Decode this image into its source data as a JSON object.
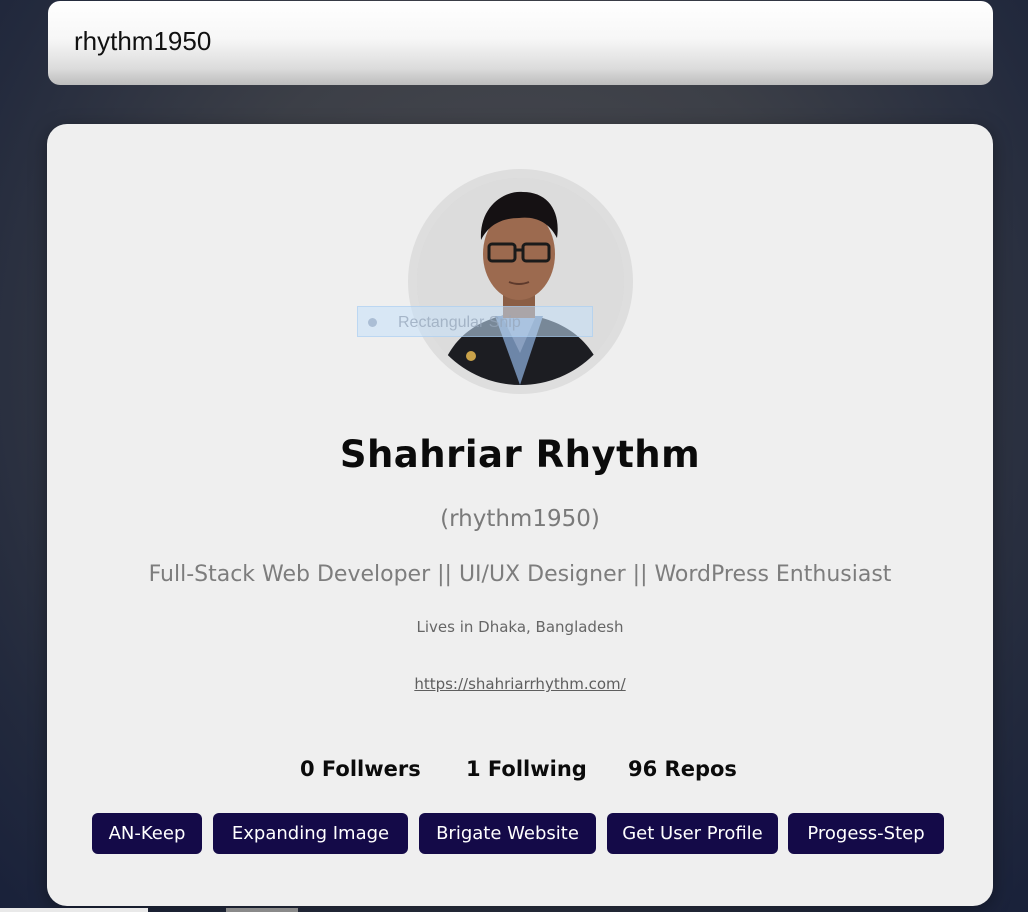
{
  "search": {
    "value": "rhythm1950"
  },
  "profile": {
    "name": "Shahriar Rhythm",
    "login": "(rhythm1950)",
    "bio": "Full-Stack Web Developer || UI/UX Designer || WordPress Enthusiast",
    "location": "Lives in Dhaka, Bangladesh",
    "website": "https://shahriarrhythm.com/"
  },
  "overlay": {
    "text": "Rectangular Snip"
  },
  "stats": {
    "followers": "0 Follwers",
    "following": "1 Follwing",
    "repos": "96 Repos"
  },
  "repos": [
    {
      "label": "AN-Keep"
    },
    {
      "label": "Expanding Image"
    },
    {
      "label": "Brigate Website"
    },
    {
      "label": "Get User Profile"
    },
    {
      "label": "Progess-Step"
    }
  ],
  "colors": {
    "card_bg": "#efefef",
    "repo_button_bg": "#140a48",
    "repo_button_text": "#ffffff",
    "muted_text": "#7a7a7a"
  }
}
